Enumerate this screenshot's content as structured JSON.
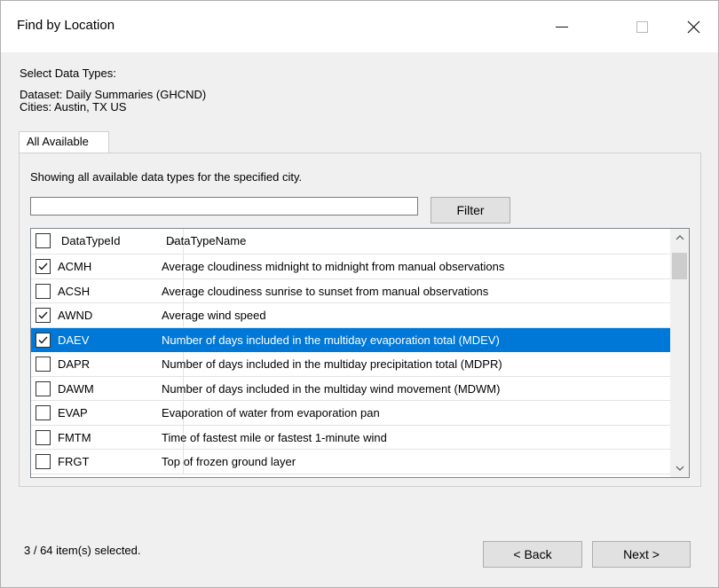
{
  "window": {
    "title": "Find by Location"
  },
  "header": {
    "select_label": "Select Data Types:",
    "dataset_line": "Dataset: Daily Summaries (GHCND)",
    "cities_line": "Cities: Austin, TX US"
  },
  "tabs": [
    {
      "label": "All Available",
      "active": true
    }
  ],
  "panel": {
    "description": "Showing all available data types for the specified city.",
    "filter_value": "",
    "filter_button": "Filter"
  },
  "grid": {
    "columns": [
      "DataTypeId",
      "DataTypeName"
    ],
    "sorted_column": "DataTypeId",
    "rows": [
      {
        "id": "ACMH",
        "name": "Average cloudiness midnight to midnight from manual observations",
        "checked": true,
        "selected": false
      },
      {
        "id": "ACSH",
        "name": "Average cloudiness sunrise to sunset from manual observations",
        "checked": false,
        "selected": false
      },
      {
        "id": "AWND",
        "name": "Average wind speed",
        "checked": true,
        "selected": false
      },
      {
        "id": "DAEV",
        "name": "Number of days included in the multiday evaporation total (MDEV)",
        "checked": true,
        "selected": true
      },
      {
        "id": "DAPR",
        "name": "Number of days included in the multiday precipitation total (MDPR)",
        "checked": false,
        "selected": false
      },
      {
        "id": "DAWM",
        "name": "Number of days included in the multiday wind movement (MDWM)",
        "checked": false,
        "selected": false
      },
      {
        "id": "EVAP",
        "name": "Evaporation of water from evaporation pan",
        "checked": false,
        "selected": false
      },
      {
        "id": "FMTM",
        "name": "Time of fastest mile or fastest 1-minute wind",
        "checked": false,
        "selected": false
      },
      {
        "id": "FRGT",
        "name": "Top of frozen ground layer",
        "checked": false,
        "selected": false
      }
    ]
  },
  "footer": {
    "status": "3 / 64 item(s) selected.",
    "back_label": "< Back",
    "next_label": "Next >"
  },
  "colors": {
    "selection": "#0078d7",
    "window_bg": "#f0f0f0"
  }
}
